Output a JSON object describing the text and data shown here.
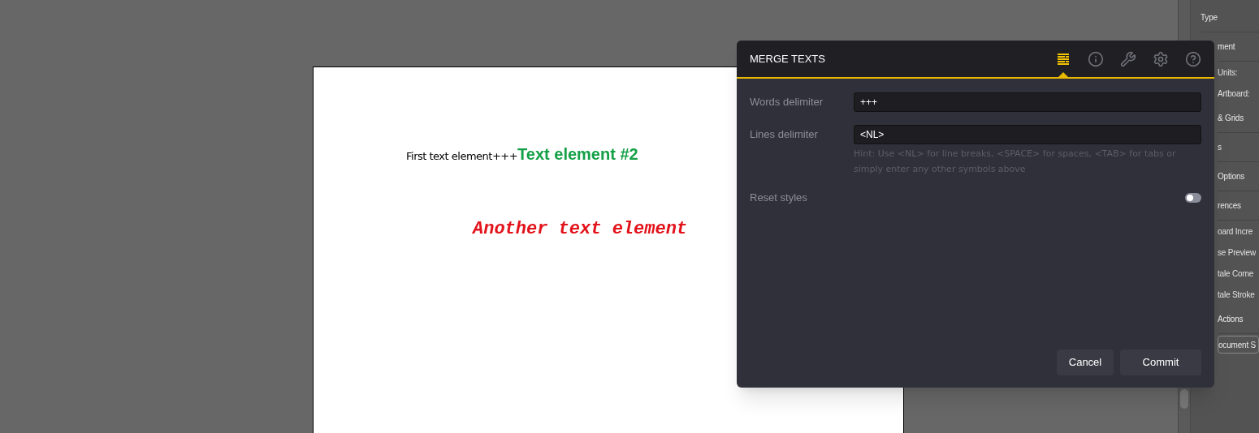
{
  "artboard": {
    "texts": [
      {
        "text": "First text element+++",
        "kind": "plain"
      },
      {
        "text": "Text element #2",
        "kind": "heading"
      },
      {
        "text": "Another text element",
        "kind": "mono"
      }
    ]
  },
  "side_panel": {
    "items": [
      {
        "text": "Type",
        "kind": "header"
      },
      {
        "text": "ment",
        "kind": "header"
      },
      {
        "text": "Units:",
        "kind": "field"
      },
      {
        "text": "Artboard:",
        "kind": "field"
      },
      {
        "text": "& Grids",
        "kind": "header"
      },
      {
        "text": "s",
        "kind": "header"
      },
      {
        "text": "Options",
        "kind": "header"
      },
      {
        "text": "rences",
        "kind": "header"
      },
      {
        "text": "oard Incre",
        "kind": "field"
      },
      {
        "text": "se Preview",
        "kind": "field"
      },
      {
        "text": "tale Corne",
        "kind": "field"
      },
      {
        "text": "tale Stroke",
        "kind": "field"
      },
      {
        "text": "Actions",
        "kind": "header"
      },
      {
        "text": "ocument S",
        "kind": "button"
      }
    ]
  },
  "dialog": {
    "title": "MERGE TEXTS",
    "tabs": [
      {
        "kind": "merge",
        "selected": true
      },
      {
        "kind": "info",
        "selected": false
      },
      {
        "kind": "key",
        "selected": false
      },
      {
        "kind": "settings",
        "selected": false
      },
      {
        "kind": "help",
        "selected": false
      }
    ],
    "fields": [
      {
        "label": "Words delimiter",
        "value": "+++"
      },
      {
        "label": "Lines delimiter",
        "value": "<NL>"
      }
    ],
    "hint": "Hint: Use <NL> for line breaks, <SPACE> for spaces, <TAB> for tabs or simply enter any other symbols above",
    "toggle": {
      "label": "Reset styles",
      "on": false
    },
    "buttons": [
      "Cancel",
      "Commit"
    ]
  }
}
